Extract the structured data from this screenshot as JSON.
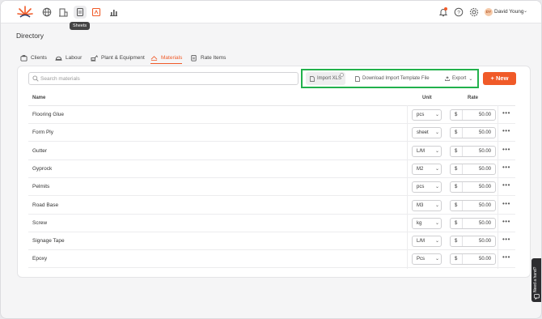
{
  "nav": {
    "tooltip": "Sheets",
    "icons": [
      "logo-icon",
      "globe-icon",
      "building-icon",
      "sheets-icon",
      "plans-icon",
      "chart-icon"
    ],
    "user": {
      "initials": "DY",
      "name": "David Young"
    }
  },
  "page": {
    "title": "Directory"
  },
  "tabs": [
    {
      "label": "Clients"
    },
    {
      "label": "Labour"
    },
    {
      "label": "Plant & Equipment"
    },
    {
      "label": "Materials"
    },
    {
      "label": "Rate Items"
    }
  ],
  "toolbar": {
    "search_placeholder": "Search materials",
    "import_label": "Import XLS",
    "download_label": "Download Import Template File",
    "export_label": "Export",
    "new_label": "+ New"
  },
  "table": {
    "headers": {
      "name": "Name",
      "unit": "Unit",
      "rate": "Rate"
    },
    "currency": "$",
    "rows": [
      {
        "name": "Flooring Glue",
        "unit": "pcs",
        "rate": "50.00"
      },
      {
        "name": "Form Ply",
        "unit": "sheet",
        "rate": "50.00"
      },
      {
        "name": "Gutter",
        "unit": "L/M",
        "rate": "50.00"
      },
      {
        "name": "Gyprock",
        "unit": "M2",
        "rate": "50.00"
      },
      {
        "name": "Pelmits",
        "unit": "pcs",
        "rate": "50.00"
      },
      {
        "name": "Road Base",
        "unit": "M3",
        "rate": "50.00"
      },
      {
        "name": "Screw",
        "unit": "kg",
        "rate": "50.00"
      },
      {
        "name": "Signage Tape",
        "unit": "L/M",
        "rate": "50.00"
      },
      {
        "name": "Epoxy",
        "unit": "Pcs",
        "rate": "50.00"
      }
    ]
  },
  "help": {
    "label": "Need a hand?"
  },
  "colors": {
    "accent": "#f05a28",
    "highlight": "#22b14c"
  }
}
